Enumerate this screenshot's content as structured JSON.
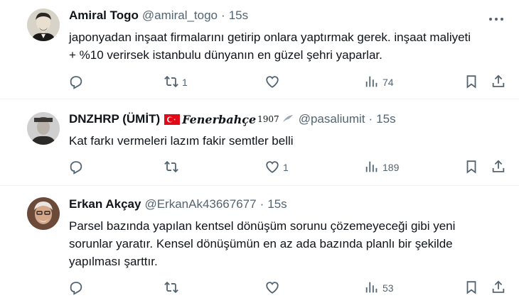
{
  "tweets": [
    {
      "name": "Amiral Togo",
      "handle": "@amiral_togo",
      "time": "15s",
      "text_lines": [
        "japonyadan inşaat firmalarını getirip onlara yaptırmak gerek. inşaat maliyeti",
        "+ %10 verirsek istanbulu dünyanın en güzel şehri yaparlar."
      ],
      "reply_count": "",
      "retweet_count": "1",
      "like_count": "",
      "views_count": "74",
      "avatar_icon": "portrait-avatar"
    },
    {
      "name": "DNZHRP (ÜMİT)",
      "name_decor": "Fenerbahçe",
      "name_decor_num": "1907",
      "handle": "@pasaliumit",
      "time": "15s",
      "text_lines": [
        "Kat farkı vermeleri lazım fakir semtler belli"
      ],
      "reply_count": "",
      "retweet_count": "",
      "like_count": "1",
      "views_count": "189",
      "avatar_icon": "portrait-avatar"
    },
    {
      "name": "Erkan Akçay",
      "handle": "@ErkanAk43667677",
      "time": "15s",
      "text_lines": [
        "Parsel bazında yapılan kentsel dönüşüm sorunu çözemeyeceği gibi yeni",
        "sorunlar yaratır. Kensel dönüşümün en az ada bazında planlı bir şekilde",
        "yapılması şarttır."
      ],
      "reply_count": "",
      "retweet_count": "",
      "like_count": "",
      "views_count": "53",
      "avatar_icon": "portrait-avatar"
    }
  ],
  "separator": "·",
  "colors": {
    "text": "#0f1419",
    "secondary": "#536471",
    "divider": "#eff3f4",
    "flag_red": "#e30a17"
  }
}
